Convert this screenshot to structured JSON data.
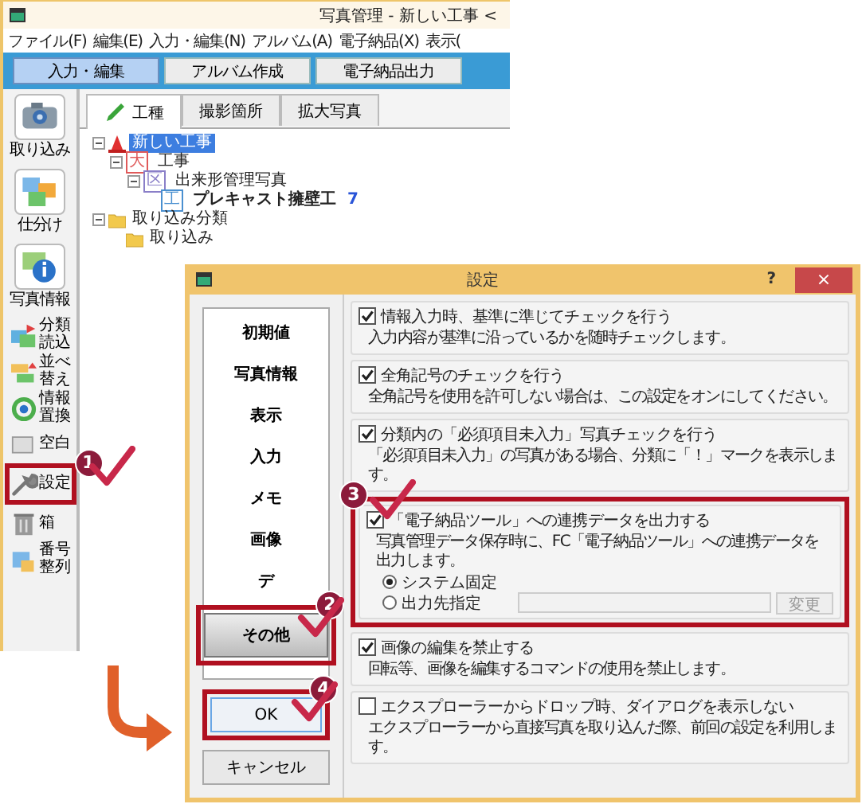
{
  "app_window": {
    "title": "写真管理 - 新しい工事 <",
    "menu": [
      "ファイル(F)",
      "編集(E)",
      "入力・編集(N)",
      "アルバム(A)",
      "電子納品(X)",
      "表示("
    ],
    "mode_tabs": [
      {
        "label": "入力・編集",
        "selected": true
      },
      {
        "label": "アルバム作成",
        "selected": false
      },
      {
        "label": "電子納品出力",
        "selected": false
      }
    ],
    "toolbar": [
      {
        "label": "取り込み",
        "kind": "large"
      },
      {
        "label": "仕分け",
        "kind": "large"
      },
      {
        "label": "写真情報",
        "kind": "large"
      },
      {
        "label": "分類読込",
        "kind": "small"
      },
      {
        "label": "並べ替え",
        "kind": "small"
      },
      {
        "label": "情報置換",
        "kind": "small"
      },
      {
        "label": "空白",
        "kind": "small"
      },
      {
        "label": "設定",
        "kind": "small",
        "callout": "1"
      },
      {
        "label": "箱",
        "kind": "small"
      },
      {
        "label": "番号整列",
        "kind": "small"
      }
    ],
    "view_tabs": [
      {
        "label": "工種",
        "selected": true
      },
      {
        "label": "撮影箇所",
        "selected": false
      },
      {
        "label": "拡大写真",
        "selected": false
      }
    ],
    "tree": [
      {
        "label": "新しい工事",
        "kind": "project",
        "selected": true,
        "expanded": true,
        "children": [
          {
            "label": "工事",
            "kind": "tagged",
            "tag": "大",
            "color": "#e05a5a",
            "selected": false,
            "expanded": true,
            "children": [
              {
                "label": "出来形管理写真",
                "kind": "tagged",
                "tag": "区",
                "color": "#8a7fc8",
                "selected": false,
                "expanded": true,
                "children": [
                  {
                    "label": "プレキャスト擁壁工",
                    "kind": "work",
                    "tag": "工",
                    "color": "#4a90d0",
                    "selected": false,
                    "count": "7"
                  }
                ]
              }
            ]
          }
        ]
      },
      {
        "label": "取り込み分類",
        "kind": "folder",
        "selected": false,
        "expanded": true,
        "children": [
          {
            "label": "取り込み",
            "kind": "folder",
            "selected": false
          }
        ]
      }
    ]
  },
  "settings_dialog": {
    "title": "設定",
    "help_button": "?",
    "close_button": "×",
    "nav": [
      {
        "label": "初期値",
        "selected": false
      },
      {
        "label": "写真情報",
        "selected": false
      },
      {
        "label": "表示",
        "selected": false
      },
      {
        "label": "入力",
        "selected": false
      },
      {
        "label": "メモ",
        "selected": false
      },
      {
        "label": "画像",
        "selected": false
      },
      {
        "label": "デ",
        "selected": false
      },
      {
        "label": "その他",
        "selected": true,
        "callout": "2"
      }
    ],
    "ok_button": {
      "label": "OK",
      "callout": "4"
    },
    "cancel_button": {
      "label": "キャンセル"
    },
    "options": [
      {
        "label": "情報入力時、基準に準じてチェックを行う",
        "checked": true,
        "description": "入力内容が基準に沿っているかを随時チェックします。"
      },
      {
        "label": "全角記号のチェックを行う",
        "checked": true,
        "description": "全角記号を使用を許可しない場合は、この設定をオンにしてください。"
      },
      {
        "label": "分類内の「必須項目未入力」写真チェックを行う",
        "checked": true,
        "description": "「必須項目未入力」の写真がある場合、分類に「！」マークを表示します。"
      },
      {
        "label": "「電子納品ツール」への連携データを出力する",
        "checked": true,
        "callout": "3",
        "description": "写真管理データ保存時に、FC「電子納品ツール」への連携データを出力します。",
        "radios": [
          {
            "label": "システム固定",
            "selected": true
          },
          {
            "label": "出力先指定",
            "selected": false
          }
        ],
        "path_field": {
          "disabled": true
        },
        "change_button": {
          "label": "変更",
          "disabled": true
        }
      },
      {
        "label": "画像の編集を禁止する",
        "checked": true,
        "description": "回転等、画像を編集するコマンドの使用を禁止します。"
      },
      {
        "label": "エクスプローラーからドロップ時、ダイアログを表示しない",
        "checked": false,
        "description": "エクスプローラーから直接写真を取り込んだ際、前回の設定を利用します。"
      }
    ]
  }
}
